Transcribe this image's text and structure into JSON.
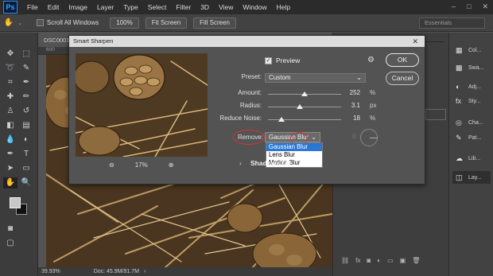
{
  "menubar": {
    "logo": "Ps",
    "items": [
      "File",
      "Edit",
      "Image",
      "Layer",
      "Type",
      "Select",
      "Filter",
      "3D",
      "View",
      "Window",
      "Help"
    ],
    "window_controls": [
      "–",
      "□",
      "✕"
    ]
  },
  "options_bar": {
    "scroll_all_label": "Scroll All Windows",
    "zoom_button": "100%",
    "fit_button": "Fit Screen",
    "fill_button": "Fill Screen",
    "workspace": "Essentials"
  },
  "document": {
    "tab_label": "DSC0001",
    "ruler_label": "600",
    "zoom": "39.93%",
    "doc_size": "Doc: 45.9M/91.7M"
  },
  "right_strip": {
    "items": [
      "Col...",
      "Swa...",
      "Adj...",
      "Sty...",
      "Cha...",
      "Pat...",
      "Lib...",
      "Lay..."
    ]
  },
  "dialog": {
    "title": "Smart Sharpen",
    "preview_label": "Preview",
    "preview_checked": true,
    "preset_label": "Preset:",
    "preset_value": "Custom",
    "amount_label": "Amount:",
    "amount_value": "252",
    "amount_unit": "%",
    "radius_label": "Radius:",
    "radius_value": "3.1",
    "radius_unit": "px",
    "noise_label": "Reduce Noise:",
    "noise_value": "18",
    "noise_unit": "%",
    "remove_label": "Remove:",
    "remove_value": "Gaussian Blur",
    "remove_options": [
      "Gaussian Blur",
      "Lens Blur",
      "Motion Blur"
    ],
    "preview_zoom": "17%",
    "shadows_label": "Shadows / H",
    "ok_label": "OK",
    "cancel_label": "Cancel"
  },
  "slider_levels": {
    "amount": 0.5,
    "radius": 0.43,
    "noise": 0.18
  },
  "colors": {
    "highlight": "#2a77d4",
    "annotation": "#dd3333"
  }
}
